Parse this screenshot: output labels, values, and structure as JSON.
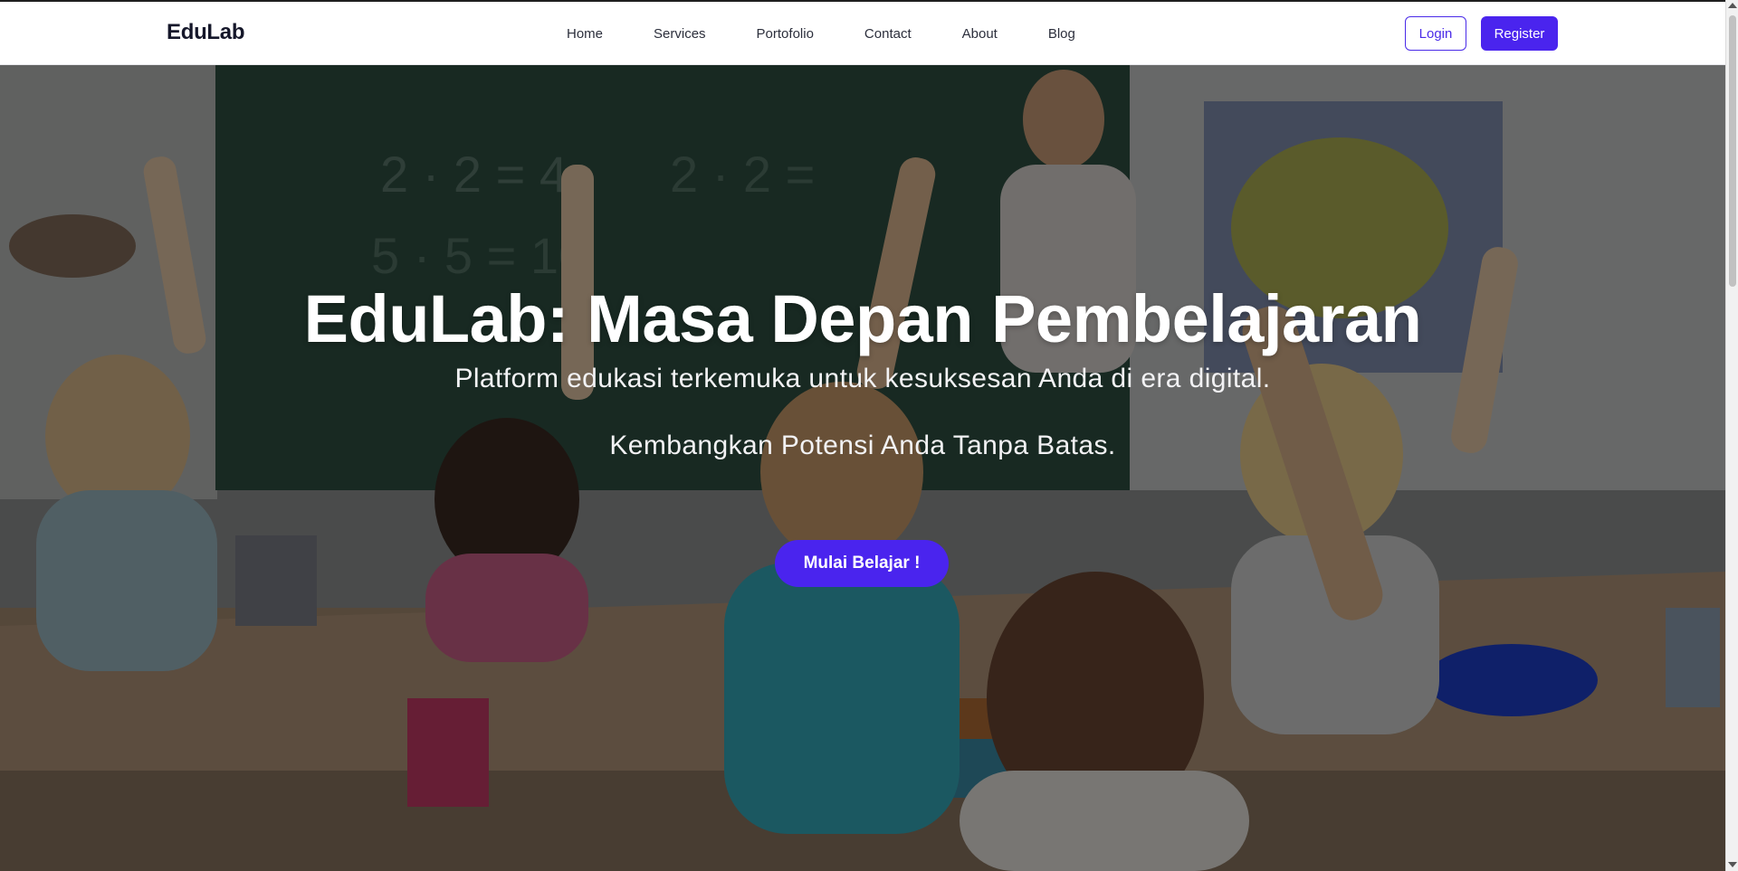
{
  "navbar": {
    "brand": "EduLab",
    "links": [
      "Home",
      "Services",
      "Portofolio",
      "Contact",
      "About",
      "Blog"
    ],
    "login_label": "Login",
    "register_label": "Register"
  },
  "hero": {
    "title": "EduLab: Masa Depan Pembelajaran",
    "subtitle": "Platform edukasi terkemuka untuk kesuksesan Anda di era digital.",
    "tagline": "Kembangkan Potensi Anda Tanpa Batas.",
    "cta_label": "Mulai Belajar !",
    "background": "classroom-photo"
  },
  "colors": {
    "accent": "#4a24ee",
    "navbar_bg": "#ffffff",
    "brand_text": "#15172a",
    "hero_overlay": "rgba(0,0,0,0.48)"
  }
}
